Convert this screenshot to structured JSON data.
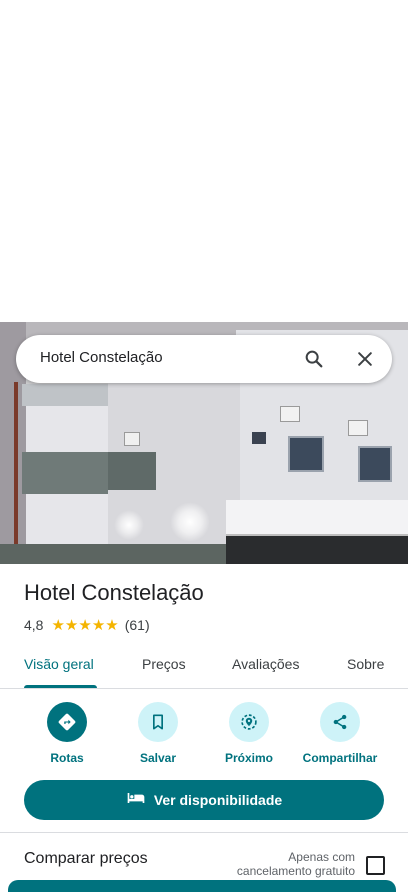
{
  "search": {
    "query": "Hotel Constelação"
  },
  "place": {
    "name": "Hotel Constelação",
    "rating": "4,8",
    "stars": 5,
    "reviews_count": "(61)"
  },
  "tabs": [
    {
      "label": "Visão geral",
      "active": true
    },
    {
      "label": "Preços"
    },
    {
      "label": "Avaliações"
    },
    {
      "label": "Sobre"
    }
  ],
  "actions": [
    {
      "label": "Rotas",
      "icon": "directions-icon"
    },
    {
      "label": "Salvar",
      "icon": "bookmark-icon"
    },
    {
      "label": "Próximo",
      "icon": "nearby-icon"
    },
    {
      "label": "Compartilhar",
      "icon": "share-icon"
    }
  ],
  "availability": {
    "label": "Ver disponibilidade",
    "icon": "bed-icon"
  },
  "compare": {
    "title": "Comparar preços",
    "free_cancellation": "Apenas com cancelamento gratuito"
  },
  "colors": {
    "accent": "#00727e",
    "accent_light": "#cef3f8",
    "star": "#f4b400"
  }
}
